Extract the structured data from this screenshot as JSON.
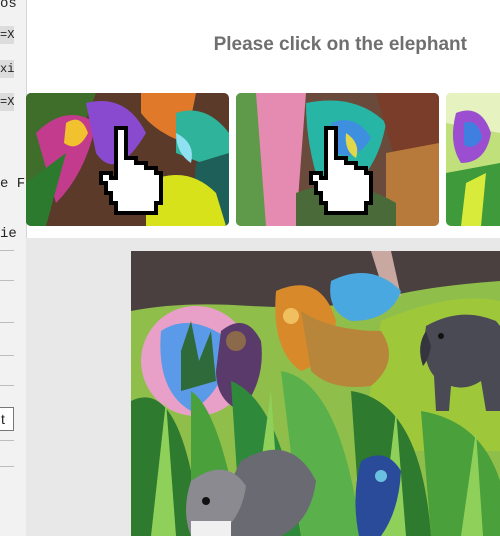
{
  "left_fragments": [
    "os",
    "=X",
    "xi",
    "=X",
    "e F",
    "ie",
    "t"
  ],
  "captcha": {
    "prompt": "Please click on the elephant"
  },
  "thumbnails": [
    {
      "label": "thumbnail-1",
      "pointer": "hand-pointer-icon"
    },
    {
      "label": "thumbnail-2",
      "pointer": "hand-pointer-icon"
    },
    {
      "label": "thumbnail-3",
      "pointer": "none"
    }
  ],
  "main_image": {
    "subject": "animals-in-grass"
  },
  "colors": {
    "prompt_text": "#6f6f6f",
    "panel_bg": "#e8e8e8"
  }
}
